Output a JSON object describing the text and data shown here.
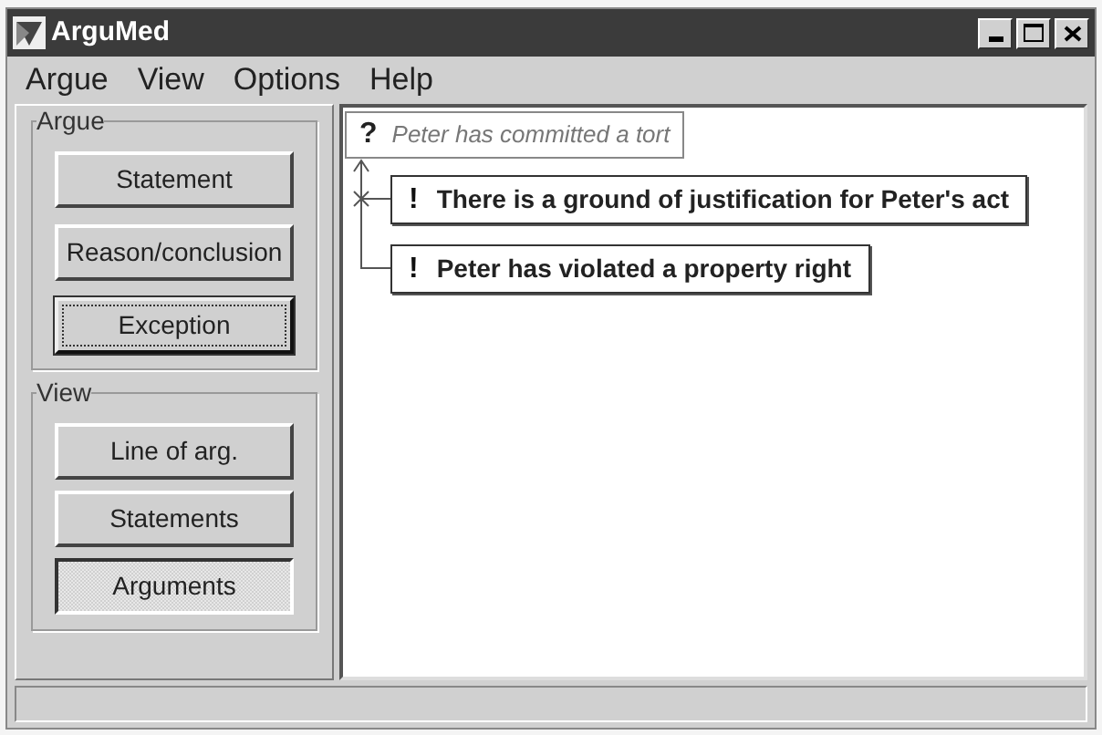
{
  "window": {
    "title": "ArguMed"
  },
  "menu": [
    {
      "label": "Argue"
    },
    {
      "label": "View"
    },
    {
      "label": "Options"
    },
    {
      "label": "Help"
    }
  ],
  "argue_group": {
    "title": "Argue",
    "buttons": [
      {
        "label": "Statement",
        "focused": false
      },
      {
        "label": "Reason/conclusion",
        "focused": false
      },
      {
        "label": "Exception",
        "focused": true
      }
    ]
  },
  "view_group": {
    "title": "View",
    "buttons": [
      {
        "label": "Line of arg.",
        "selected": false
      },
      {
        "label": "Statements",
        "selected": false
      },
      {
        "label": "Arguments",
        "selected": true
      }
    ]
  },
  "diagram": {
    "nodes": [
      {
        "kind": "issue",
        "mark": "?",
        "text": "Peter has committed a tort"
      },
      {
        "kind": "statement",
        "mark": "!",
        "text": "There is a ground of justification for Peter's act"
      },
      {
        "kind": "statement",
        "mark": "!",
        "text": "Peter has violated a property right"
      }
    ]
  }
}
